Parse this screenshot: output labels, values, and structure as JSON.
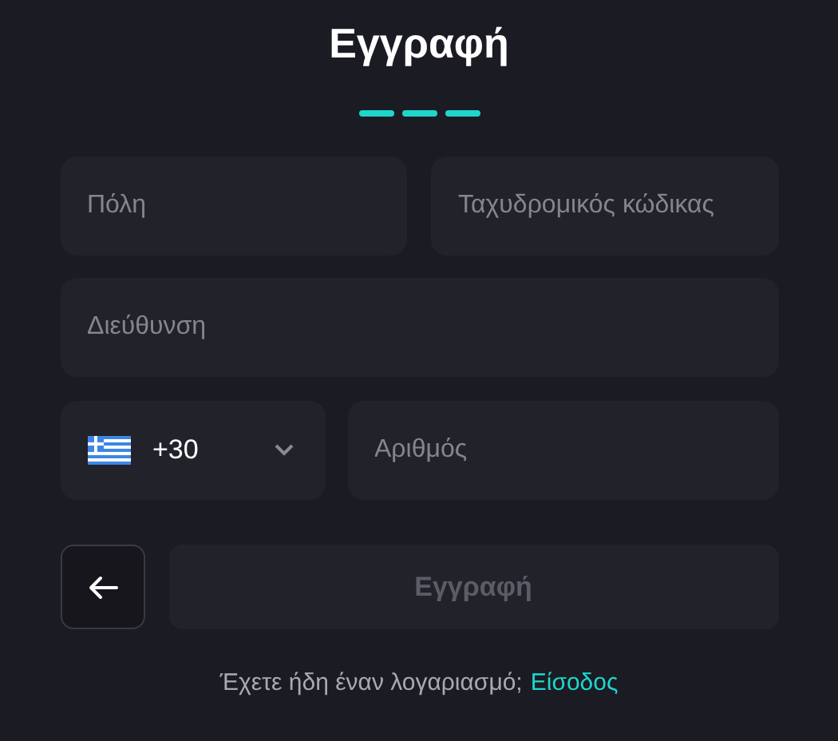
{
  "title": "Εγγραφή",
  "steps": [
    {
      "done": true
    },
    {
      "done": true
    },
    {
      "done": true
    }
  ],
  "fields": [
    {
      "placeholder": "Πόλη"
    },
    {
      "placeholder": "Ταχυδρομικός κώδικας"
    },
    {
      "placeholder": "Διεύθυνση"
    }
  ],
  "phone": {
    "country_code": "+30",
    "placeholder": "Αριθμός"
  },
  "submit": {
    "label": "Εγγραφή",
    "disabled": true
  },
  "footer": {
    "text": "Έχετε ήδη έναν λογαριασμό;",
    "link": "Είσοδος"
  }
}
